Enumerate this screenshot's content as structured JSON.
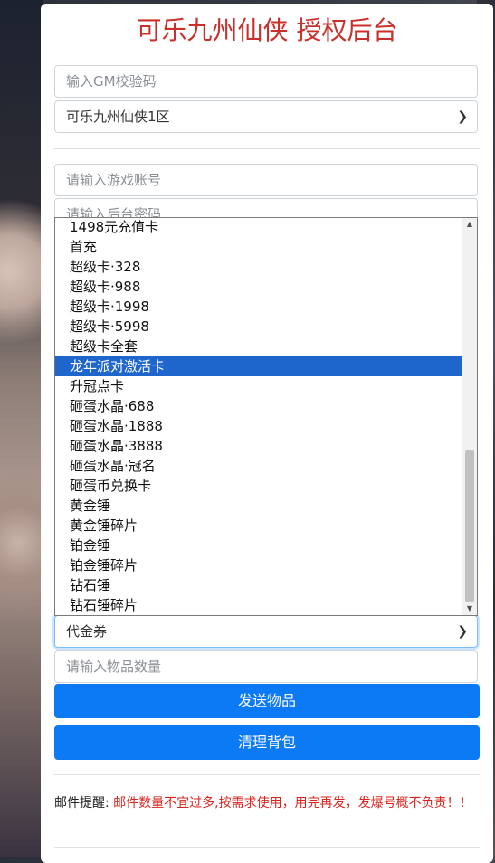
{
  "page": {
    "title": "可乐九州仙侠 授权后台"
  },
  "form": {
    "gm_code_placeholder": "输入GM校验码",
    "server_select": "可乐九州仙侠1区",
    "account_placeholder": "请输入游戏账号",
    "password_placeholder": "请输入后台密码",
    "item_select": "代金券",
    "quantity_placeholder": "请输入物品数量"
  },
  "dropdown": {
    "options": [
      "1498元充值卡",
      "首充",
      "超级卡·328",
      "超级卡·988",
      "超级卡·1998",
      "超级卡·5998",
      "超级卡全套",
      "龙年派对激活卡",
      "升冠点卡",
      "砸蛋水晶·688",
      "砸蛋水晶·1888",
      "砸蛋水晶·3888",
      "砸蛋水晶·冠名",
      "砸蛋币兑换卡",
      "黄金锤",
      "黄金锤碎片",
      "铂金锤",
      "铂金锤碎片",
      "钻石锤",
      "钻石锤碎片"
    ],
    "highlighted": "龙年派对激活卡"
  },
  "buttons": {
    "send": "发送物品",
    "clear": "清理背包"
  },
  "notice": {
    "label": "邮件提醒:",
    "text": " 邮件数量不宜过多,按需求使用，用完再发，发爆号概不负责！！"
  },
  "colors": {
    "title": "#c9302c",
    "button": "#0d7af5",
    "highlight": "#1f66cc",
    "warning": "#d9241e"
  }
}
